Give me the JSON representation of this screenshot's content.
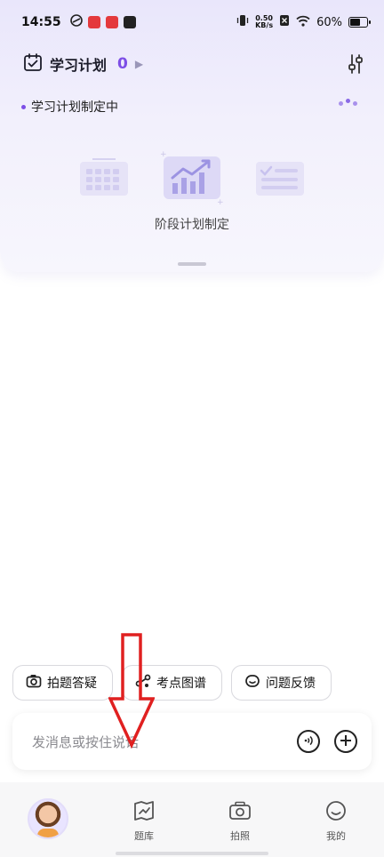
{
  "status_bar": {
    "time": "14:55",
    "netspeed_value": "0.50",
    "netspeed_unit": "KB/s",
    "battery": "60%"
  },
  "plan": {
    "title": "学习计划",
    "count": "0",
    "status": "学习计划制定中",
    "stage_label": "阶段计划制定"
  },
  "chips": [
    {
      "label": "拍题答疑",
      "icon": "camera-icon"
    },
    {
      "label": "考点图谱",
      "icon": "graph-icon"
    },
    {
      "label": "问题反馈",
      "icon": "feedback-icon"
    }
  ],
  "input": {
    "placeholder": "发消息或按住说话"
  },
  "nav": {
    "items": [
      {
        "label": "",
        "icon": "avatar"
      },
      {
        "label": "题库",
        "icon": "question-bank-icon"
      },
      {
        "label": "拍照",
        "icon": "camera-icon"
      },
      {
        "label": "我的",
        "icon": "profile-icon"
      }
    ]
  },
  "colors": {
    "accent": "#7d4ee6",
    "card_bg": "#efedfc",
    "annotation": "#e02020"
  }
}
